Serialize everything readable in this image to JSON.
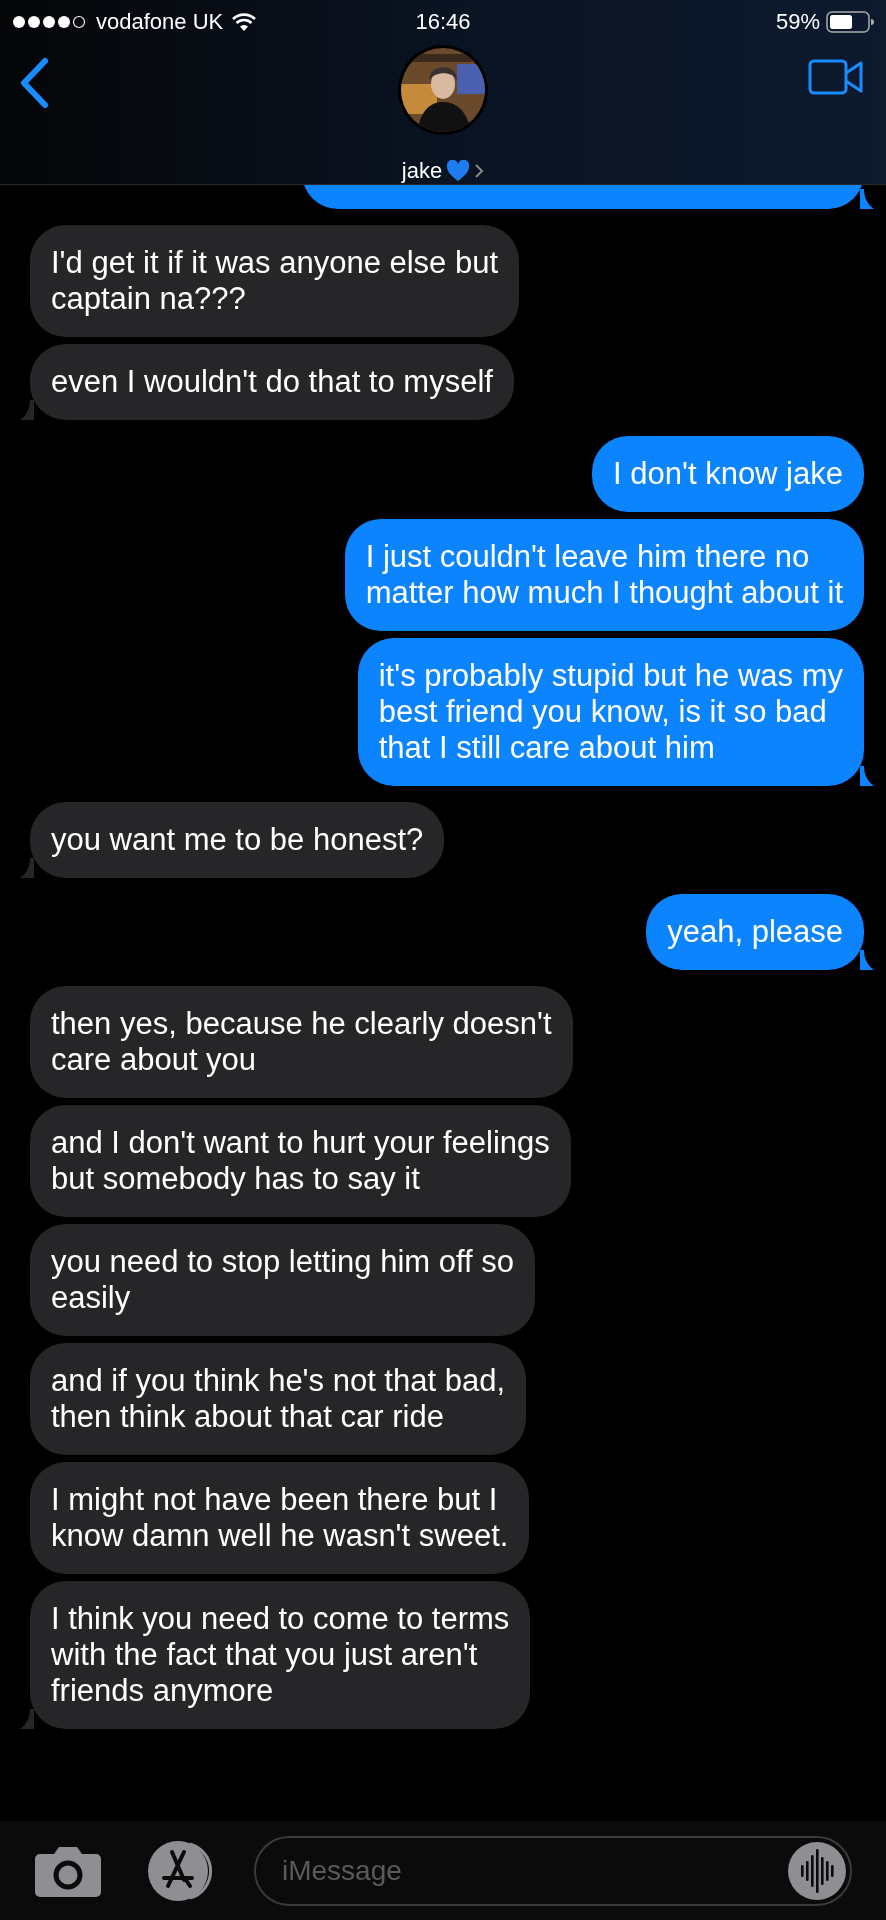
{
  "status_bar": {
    "carrier": "vodafone UK",
    "time": "16:46",
    "battery": "59%"
  },
  "contact": {
    "name": "jake"
  },
  "messages": [
    {
      "kind": "sent",
      "cut": true,
      "tail": true
    },
    {
      "kind": "received",
      "text": "I'd get it if it was anyone else but\ncaptain na???",
      "tail": false
    },
    {
      "kind": "received",
      "text": "even I wouldn't do that to myself",
      "tail": true
    },
    {
      "kind": "sent",
      "text": "I don't know jake",
      "tail": false
    },
    {
      "kind": "sent",
      "text": "I just couldn't leave him there no\nmatter how much I thought about it",
      "tail": false
    },
    {
      "kind": "sent",
      "text": "it's probably stupid but he was my\nbest friend you know, is it so bad\nthat I still care about him",
      "tail": true
    },
    {
      "kind": "received",
      "text": "you want me to be honest?",
      "tail": true
    },
    {
      "kind": "sent",
      "text": "yeah, please",
      "tail": true
    },
    {
      "kind": "received",
      "text": "then yes, because he clearly doesn't\ncare about you",
      "tail": false
    },
    {
      "kind": "received",
      "text": "and I don't want to hurt your feelings\nbut somebody has to say it",
      "tail": false
    },
    {
      "kind": "received",
      "text": "you need to stop letting him off so\neasily",
      "tail": false
    },
    {
      "kind": "received",
      "text": "and if you think he's not that bad,\nthen think about that car ride",
      "tail": false
    },
    {
      "kind": "received",
      "text": "I might not have been there but I\nknow damn well he wasn't sweet.",
      "tail": false
    },
    {
      "kind": "received",
      "text": "I think you need to come to terms\nwith the fact that you just aren't\nfriends anymore",
      "tail": true
    }
  ],
  "composer": {
    "placeholder": "iMessage"
  }
}
